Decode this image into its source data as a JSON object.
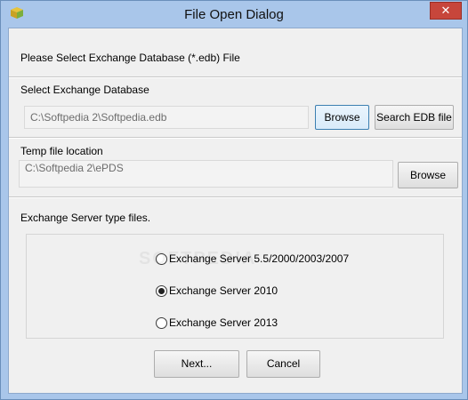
{
  "window": {
    "title": "File Open Dialog",
    "close_label": "✕"
  },
  "header": {
    "instruction": "Please Select Exchange Database (*.edb) File"
  },
  "database": {
    "section_label": "Select Exchange Database",
    "path": "C:\\Softpedia 2\\Softpedia.edb",
    "browse_label": "Browse",
    "search_label": "Search EDB file"
  },
  "temp": {
    "section_label": "Temp file location",
    "path": "C:\\Softpedia 2\\ePDS",
    "browse_label": "Browse"
  },
  "server": {
    "section_label": "Exchange Server type files.",
    "options": [
      {
        "label": "Exchange Server 5.5/2000/2003/2007",
        "selected": false
      },
      {
        "label": "Exchange Server 2010",
        "selected": true
      },
      {
        "label": "Exchange Server 2013",
        "selected": false
      }
    ]
  },
  "footer": {
    "next_label": "Next...",
    "cancel_label": "Cancel"
  },
  "watermark": "SOFTPEDIA",
  "colors": {
    "titlebar": "#a9c6ea",
    "close_button": "#c7463b",
    "dialog_background": "#f0f0f0",
    "focused_border": "#3c7fb1"
  }
}
